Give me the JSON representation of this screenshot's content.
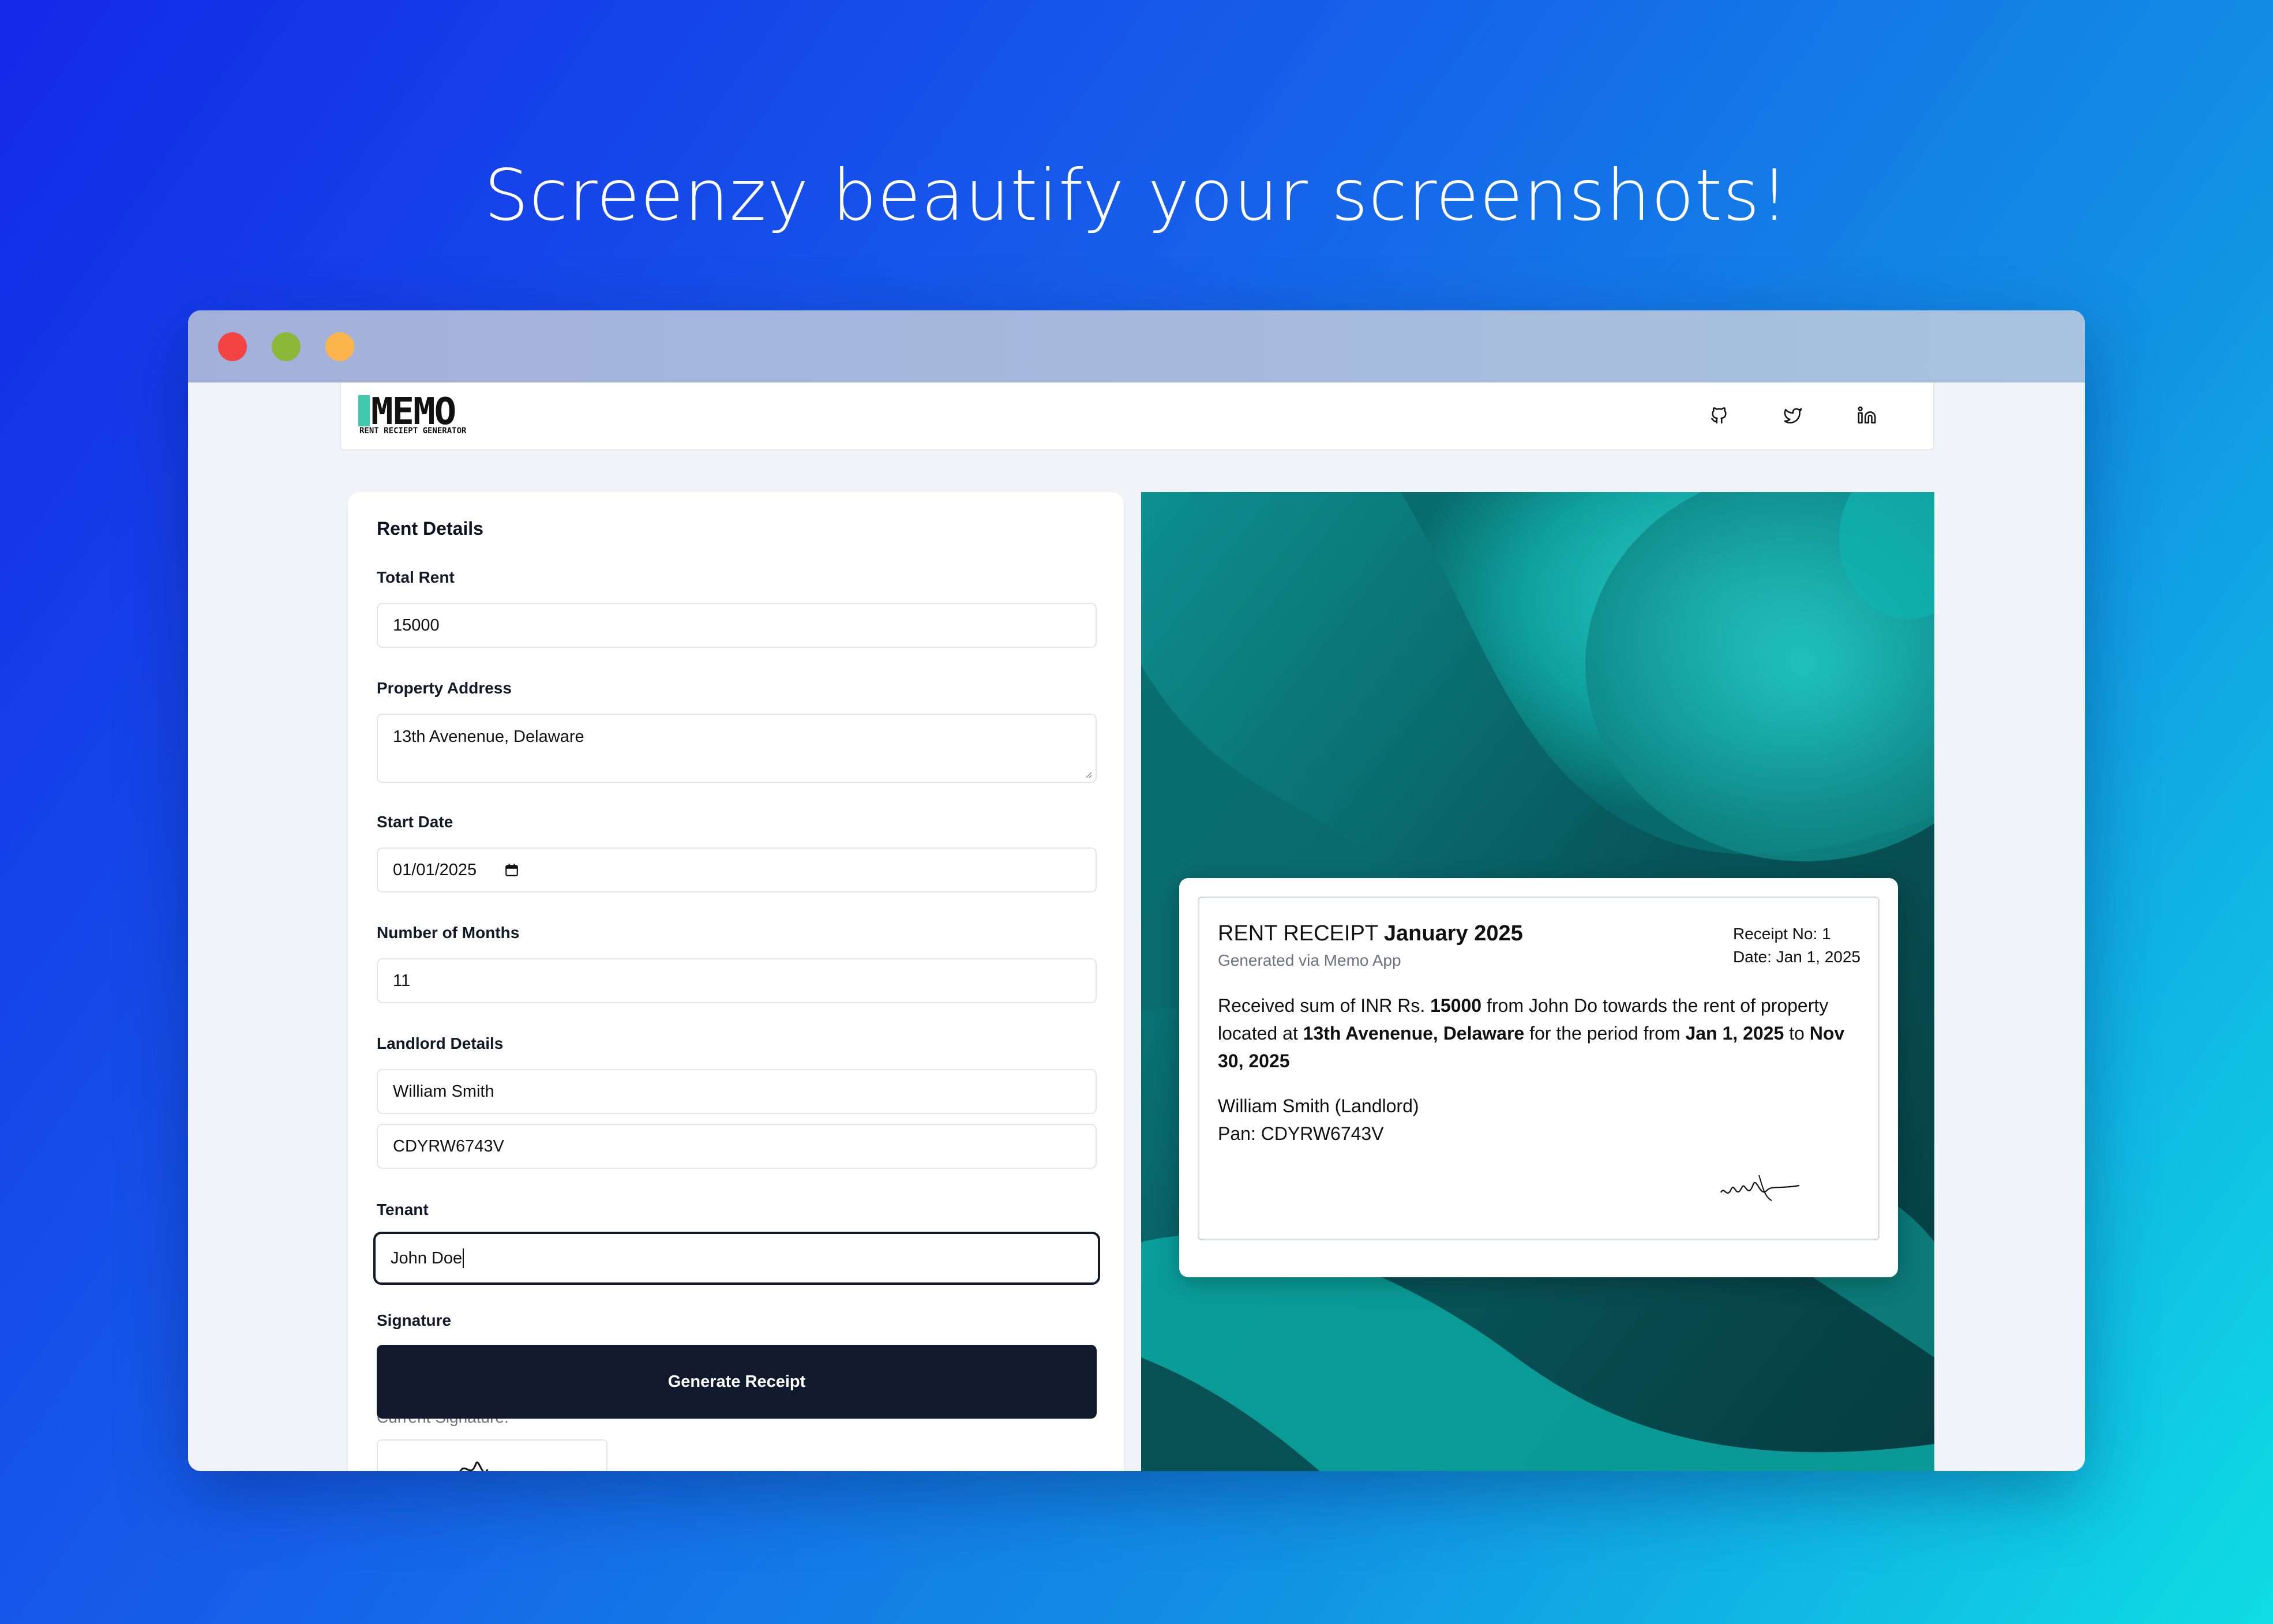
{
  "headline": "Screenzy beautify your screenshots!",
  "app": {
    "logo_text": "MEMO",
    "logo_subtitle": "RENT RECIEPT GENERATOR"
  },
  "nav": {
    "icons": [
      "github-icon",
      "twitter-icon",
      "linkedin-icon"
    ]
  },
  "form": {
    "title": "Rent Details",
    "total_rent_label": "Total Rent",
    "total_rent_value": "15000",
    "address_label": "Property Address",
    "address_value": "13th Avenenue, Delaware",
    "start_date_label": "Start Date",
    "start_date_value": "01/01/2025",
    "months_label": "Number of Months",
    "months_value": "11",
    "landlord_label": "Landlord Details",
    "landlord_name": "William Smith",
    "landlord_pan": "CDYRW6743V",
    "tenant_label": "Tenant",
    "tenant_value": "John Doe",
    "signature_label": "Signature",
    "generate_button": "Generate Receipt",
    "current_signature_label": "Current Signature:"
  },
  "receipt": {
    "title_prefix": "RENT RECEIPT",
    "title_month": "January 2025",
    "subtitle": "Generated via Memo App",
    "receipt_no": "Receipt No: 1",
    "date": "Date: Jan 1, 2025",
    "body_1": "Received sum of INR Rs.",
    "amount": "15000",
    "body_2": "from John Do towards the rent of property located at",
    "address": "13th Avenenue, Delaware",
    "body_3": "for the period from",
    "from_date": "Jan 1, 2025",
    "body_4": "to",
    "to_date": "Nov 30, 2025",
    "landlord_line": "William Smith (Landlord)",
    "pan_line": "Pan: CDYRW6743V"
  },
  "colors": {
    "accent": "#111a2c",
    "logo_accent": "#3fc9ad",
    "preview_bg": "#0a6e70"
  }
}
